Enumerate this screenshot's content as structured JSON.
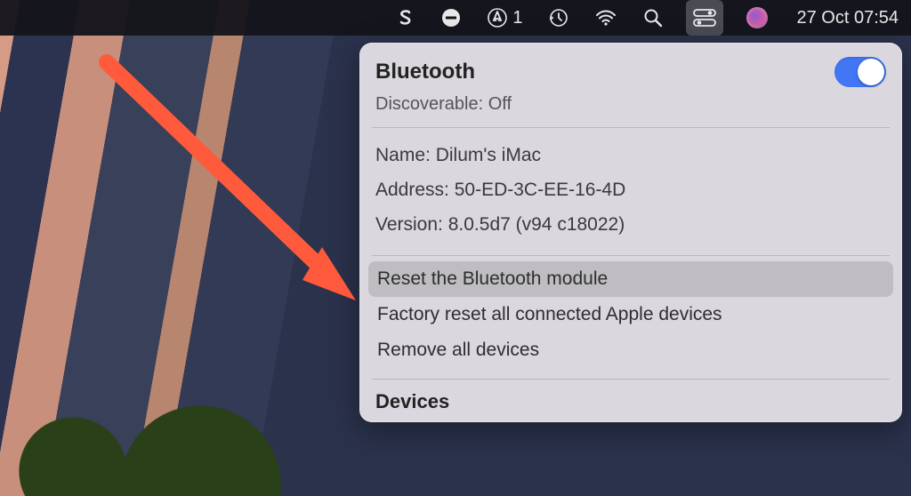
{
  "menubar": {
    "appstore_badge": "1",
    "datetime": "27 Oct  07:54"
  },
  "panel": {
    "title": "Bluetooth",
    "toggle_on": true,
    "discoverable_label": "Discoverable:",
    "discoverable_value": "Off",
    "name_label": "Name:",
    "name_value": "Dilum's iMac",
    "address_label": "Address:",
    "address_value": "50-ED-3C-EE-16-4D",
    "version_label": "Version:",
    "version_value": "8.0.5d7 (v94 c18022)",
    "actions": {
      "reset_module": "Reset the Bluetooth module",
      "factory_reset": "Factory reset all connected Apple devices",
      "remove_all": "Remove all devices"
    },
    "devices_heading": "Devices"
  }
}
